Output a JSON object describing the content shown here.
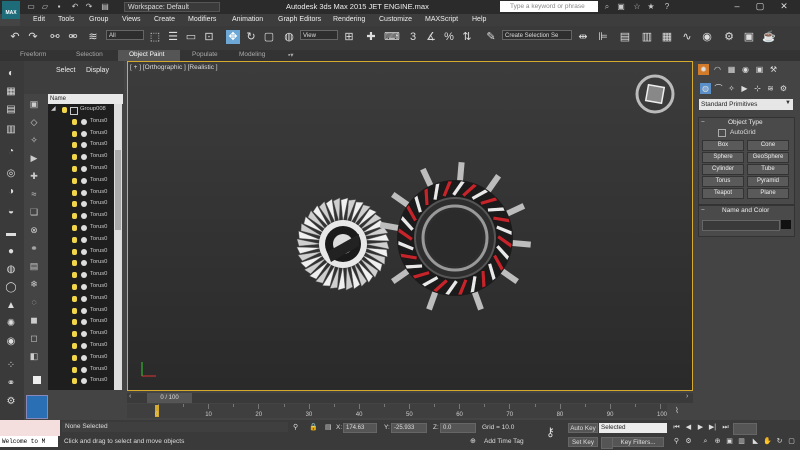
{
  "app": {
    "logo_text": "MAX",
    "workspace": "Workspace: Default",
    "window_title": "Autodesk 3ds Max  2015     JET ENGINE.max",
    "help_search_placeholder": "Type a keyword or phrase"
  },
  "menubar": [
    "Edit",
    "Tools",
    "Group",
    "Views",
    "Create",
    "Modifiers",
    "Animation",
    "Graph Editors",
    "Rendering",
    "Customize",
    "MAXScript",
    "Help"
  ],
  "toolbar": {
    "selection_filter": "All",
    "ref_coord": "View",
    "named_selection": "Create Selection Se"
  },
  "ribbon_tabs": [
    "Freeform",
    "Selection",
    "Object Paint",
    "Populate",
    "Modeling"
  ],
  "ribbon_active": "Object Paint",
  "scene_explorer": {
    "tabs": [
      "Select",
      "Display"
    ],
    "column_header": "Name",
    "group_name": "Group008",
    "items": [
      "Torus0",
      "Torus0",
      "Torus0",
      "Torus0",
      "Torus0",
      "Torus0",
      "Torus0",
      "Torus0",
      "Torus0",
      "Torus0",
      "Torus0",
      "Torus0",
      "Torus0",
      "Torus0",
      "Torus0",
      "Torus0",
      "Torus0",
      "Torus0",
      "Torus0",
      "Torus0",
      "Torus0",
      "Torus0",
      "Torus0"
    ]
  },
  "viewport": {
    "label": "[ + ] [Orthographic ] [Realistic ]",
    "border_color": "#d6ab2d"
  },
  "command_panel": {
    "category": "Standard Primitives",
    "object_type_title": "Object Type",
    "autogrid_label": "AutoGrid",
    "buttons": [
      "Box",
      "Cone",
      "Sphere",
      "GeoSphere",
      "Cylinder",
      "Tube",
      "Torus",
      "Pyramid",
      "Teapot",
      "Plane"
    ],
    "name_and_color_title": "Name and Color",
    "object_color": "#111111"
  },
  "timeline": {
    "frame_display": "0 / 100",
    "tick_labels": [
      "0",
      "10",
      "20",
      "30",
      "40",
      "50",
      "60",
      "70",
      "80",
      "90",
      "100"
    ]
  },
  "status": {
    "selection": "None Selected",
    "prompt": "Click and drag to select and move objects",
    "listener": "Welcome to M",
    "x_label": "X:",
    "x_value": "174.63",
    "y_label": "Y:",
    "y_value": "-25.933",
    "z_label": "Z:",
    "z_value": "0.0",
    "grid": "Grid = 10.0",
    "add_time_tag": "Add Time Tag",
    "auto_key": "Auto Key",
    "set_key": "Set Key",
    "key_filter_value": "Selected",
    "key_filters": "Key Filters..."
  }
}
